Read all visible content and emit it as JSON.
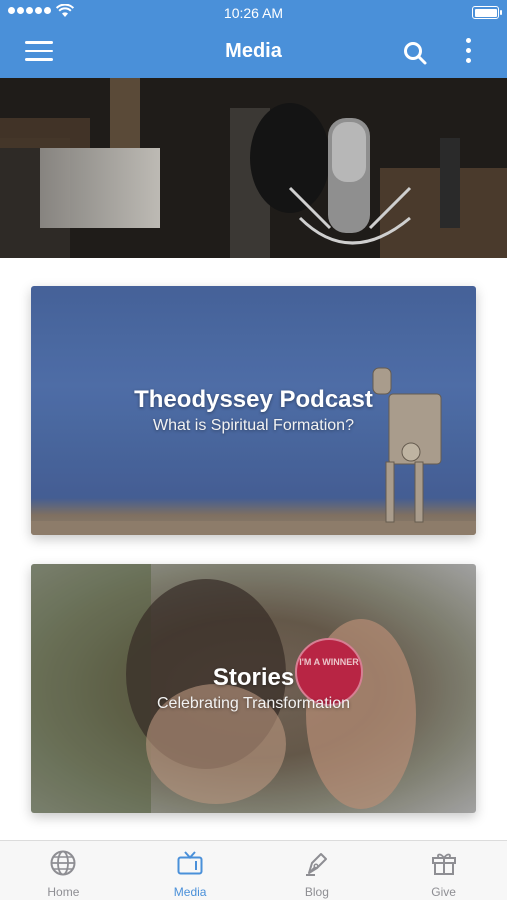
{
  "status_bar": {
    "time": "10:26 AM"
  },
  "nav": {
    "title": "Media"
  },
  "cards": [
    {
      "title": "Theodyssey Podcast",
      "subtitle": "What is Spiritual Formation?",
      "badge_text": ""
    },
    {
      "title": "Stories",
      "subtitle": "Celebrating Transformation",
      "badge_text": "I'M A WINNER"
    }
  ],
  "tabs": [
    {
      "label": "Home",
      "icon": "globe-icon"
    },
    {
      "label": "Media",
      "icon": "tv-icon",
      "active": true
    },
    {
      "label": "Blog",
      "icon": "pen-icon"
    },
    {
      "label": "Give",
      "icon": "gift-icon"
    }
  ],
  "colors": {
    "primary": "#4a90d9",
    "tab_inactive": "#8e8e93"
  }
}
